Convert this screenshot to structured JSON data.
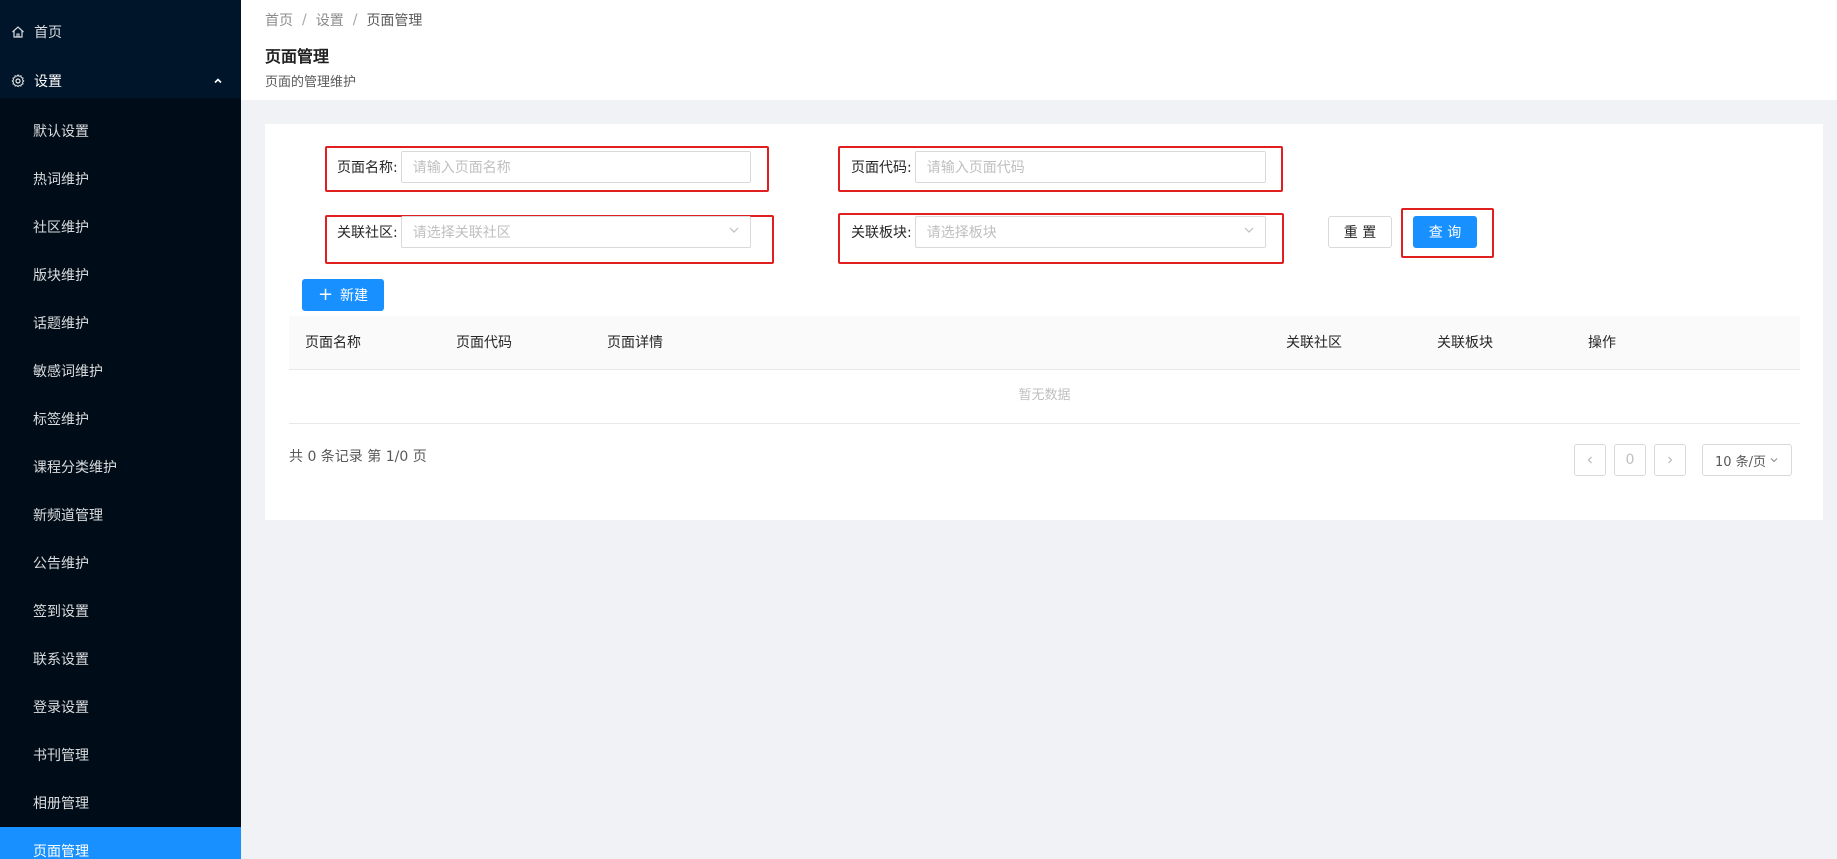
{
  "sidebar": {
    "home_label": "首页",
    "parent_label": "设置",
    "items": [
      {
        "label": "默认设置"
      },
      {
        "label": "热词维护"
      },
      {
        "label": "社区维护"
      },
      {
        "label": "版块维护"
      },
      {
        "label": "话题维护"
      },
      {
        "label": "敏感词维护"
      },
      {
        "label": "标签维护"
      },
      {
        "label": "课程分类维护"
      },
      {
        "label": "新频道管理"
      },
      {
        "label": "公告维护"
      },
      {
        "label": "签到设置"
      },
      {
        "label": "联系设置"
      },
      {
        "label": "登录设置"
      },
      {
        "label": "书刊管理"
      },
      {
        "label": "相册管理"
      },
      {
        "label": "页面管理"
      }
    ],
    "active_item": "页面管理"
  },
  "breadcrumb": [
    "首页",
    "设置",
    "页面管理"
  ],
  "page": {
    "title": "页面管理",
    "subtitle": "页面的管理维护"
  },
  "filters": {
    "page_name": {
      "label": "页面名称:",
      "placeholder": "请输入页面名称"
    },
    "page_code": {
      "label": "页面代码:",
      "placeholder": "请输入页面代码"
    },
    "community": {
      "label": "关联社区:",
      "placeholder": "请选择关联社区"
    },
    "section": {
      "label": "关联板块:",
      "placeholder": "请选择板块"
    },
    "reset_label": "重 置",
    "query_label": "查 询"
  },
  "toolbar": {
    "new_label": "新建"
  },
  "table": {
    "columns": [
      "页面名称",
      "页面代码",
      "页面详情",
      "关联社区",
      "关联板块",
      "操作"
    ],
    "rows": [],
    "empty_text": "暂无数据"
  },
  "pagination": {
    "summary": "共 0 条记录 第 1/0 页",
    "current_page": "0",
    "page_size": "10 条/页"
  },
  "colors": {
    "sidebar_bg": "#001529",
    "submenu_bg": "#000c17",
    "primary": "#1890ff",
    "highlight_border": "#e02020"
  }
}
